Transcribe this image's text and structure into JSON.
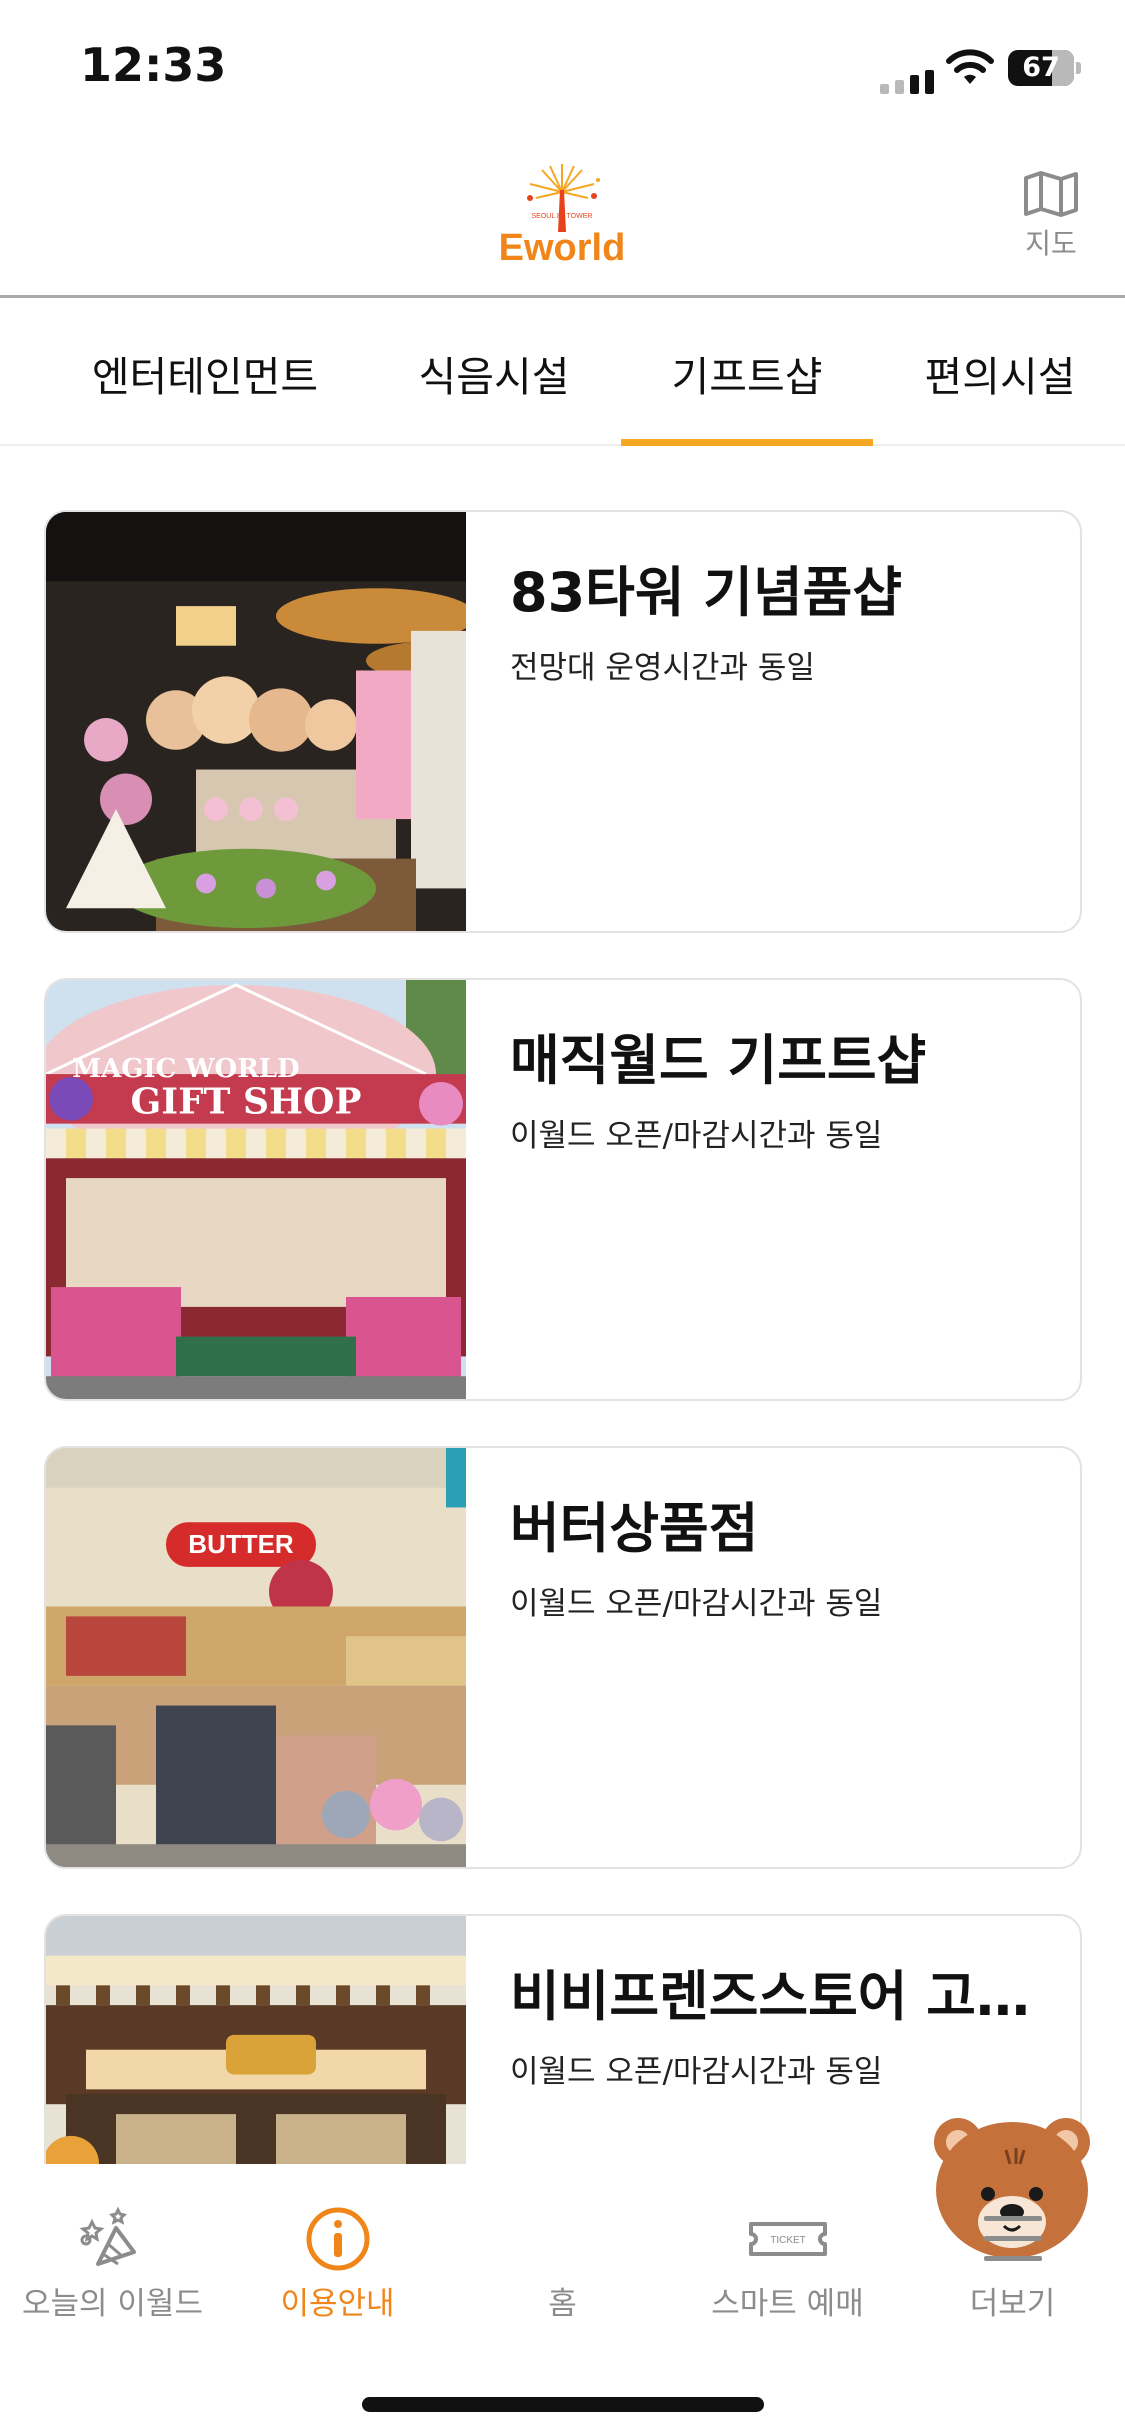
{
  "status_bar": {
    "time": "12:33",
    "battery": "67"
  },
  "header": {
    "logo_text": "Eworld",
    "logo_subtext": "SEOUL 83 TOWER",
    "map_label": "지도"
  },
  "tabs": [
    {
      "label": "엔터테인먼트",
      "active": false
    },
    {
      "label": "식음시설",
      "active": false
    },
    {
      "label": "기프트샵",
      "active": true
    },
    {
      "label": "편의시설",
      "active": false
    }
  ],
  "shops": [
    {
      "title": "83타워 기념품샵",
      "hours": "전망대 운영시간과 동일",
      "image": "souvenir-shop-photo"
    },
    {
      "title": "매직월드 기프트샵",
      "hours": "이월드 오픈/마감시간과 동일",
      "image": "magic-world-gift-shop-photo",
      "sign_line1": "MAGIC WORLD",
      "sign_line2": "GIFT  SHOP"
    },
    {
      "title": "버터상품점",
      "hours": "이월드 오픈/마감시간과 동일",
      "image": "butter-store-photo",
      "sign": "BUTTER"
    },
    {
      "title": "비비프렌즈스토어 고…",
      "hours": "이월드 오픈/마감시간과 동일",
      "image": "bebe-friends-store-photo"
    }
  ],
  "bottom_nav": [
    {
      "label": "오늘의 이월드",
      "icon": "confetti-icon",
      "active": false
    },
    {
      "label": "이용안내",
      "icon": "info-icon",
      "active": true
    },
    {
      "label": "홈",
      "icon": "bear-mascot-icon",
      "active": false
    },
    {
      "label": "스마트 예매",
      "icon": "ticket-icon",
      "ticket_text": "TICKET",
      "active": false
    },
    {
      "label": "더보기",
      "icon": "menu-icon",
      "active": false
    }
  ],
  "colors": {
    "accent": "#f7a823",
    "active_nav": "#f08519",
    "inactive": "#8c8c8c"
  }
}
